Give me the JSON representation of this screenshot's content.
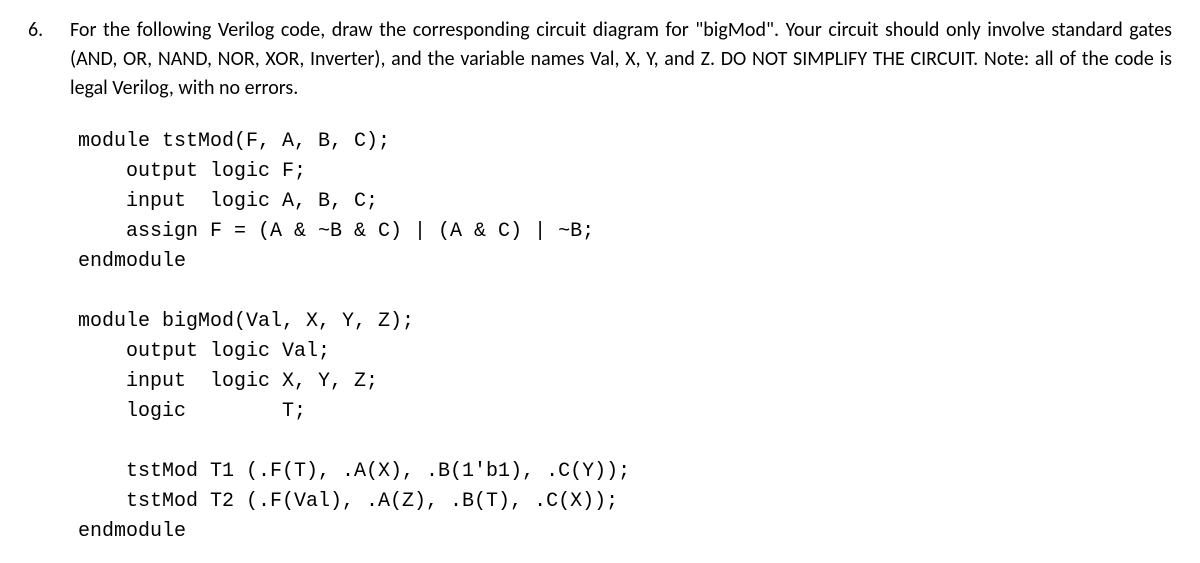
{
  "question": {
    "number": "6.",
    "prompt": "For the following Verilog code, draw the corresponding circuit diagram for \"bigMod\".  Your circuit should only involve standard gates (AND, OR, NAND, NOR, XOR, Inverter), and the variable names Val, X, Y, and Z.  DO NOT SIMPLIFY THE CIRCUIT.  Note: all of the code is legal Verilog, with no errors."
  },
  "code": {
    "module1": {
      "line1": "module tstMod(F, A, B, C);",
      "line2": "output logic F;",
      "line3": "input  logic A, B, C;",
      "line4": "assign F = (A & ~B & C) | (A & C) | ~B;",
      "line5": "endmodule"
    },
    "module2": {
      "line1": "module bigMod(Val, X, Y, Z);",
      "line2": "output logic Val;",
      "line3": "input  logic X, Y, Z;",
      "line4": "logic        T;",
      "line5a": "tstMod T1 (.F(T), .A(X), .B(1'b1), .C(Y));",
      "line5b": "tstMod T2 (.F(Val), .A(Z), .B(T), .C(X));",
      "line6": "endmodule"
    }
  }
}
